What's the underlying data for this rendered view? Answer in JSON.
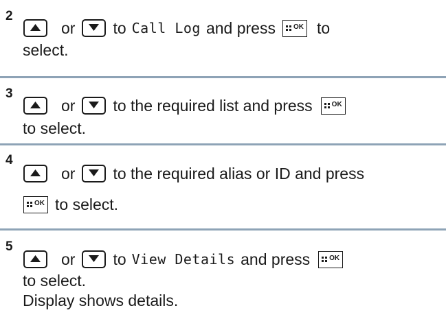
{
  "steps": [
    {
      "number": "2",
      "or_text": "or",
      "before_menu": "to",
      "menu_item": "Call Log",
      "after_menu": "and press",
      "after_ok": "to",
      "line2": "select."
    },
    {
      "number": "3",
      "or_text": "or",
      "text": "to the required list and press",
      "line2": "to select."
    },
    {
      "number": "4",
      "or_text": "or",
      "text": "to the required alias or ID and press",
      "line2": "to select."
    },
    {
      "number": "5",
      "or_text": "or",
      "before_menu": "to",
      "menu_item": "View Details",
      "after_menu": "and press",
      "line2": "to select.",
      "line3": "Display shows details."
    }
  ],
  "icons": {
    "up": "up-arrow-button-icon",
    "down": "down-arrow-button-icon",
    "ok": "menu-ok-button-icon",
    "ok_label": "OK"
  },
  "colors": {
    "divider": "#8ea3b6",
    "text": "#1a1a1a"
  }
}
